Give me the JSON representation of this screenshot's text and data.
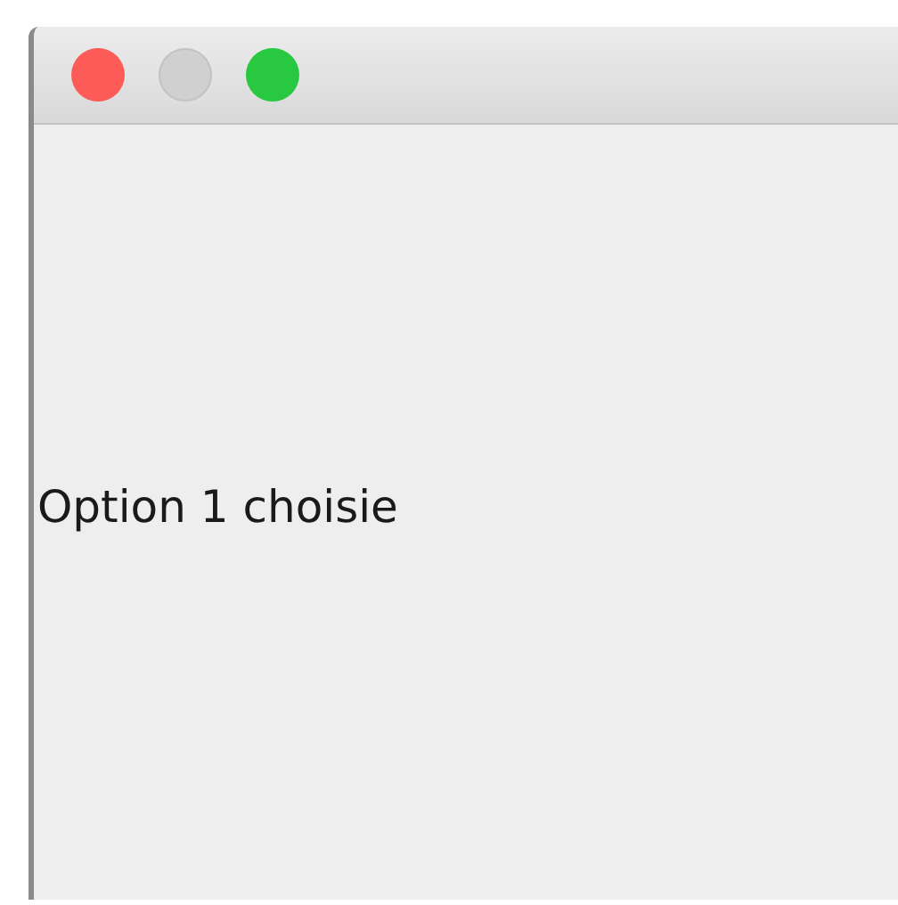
{
  "window": {
    "buttons": [
      {
        "kind": "close",
        "disabled": false
      },
      {
        "kind": "minimize",
        "disabled": true
      },
      {
        "kind": "zoom",
        "disabled": false
      }
    ]
  },
  "label": {
    "text": "Option 1 choisie"
  }
}
